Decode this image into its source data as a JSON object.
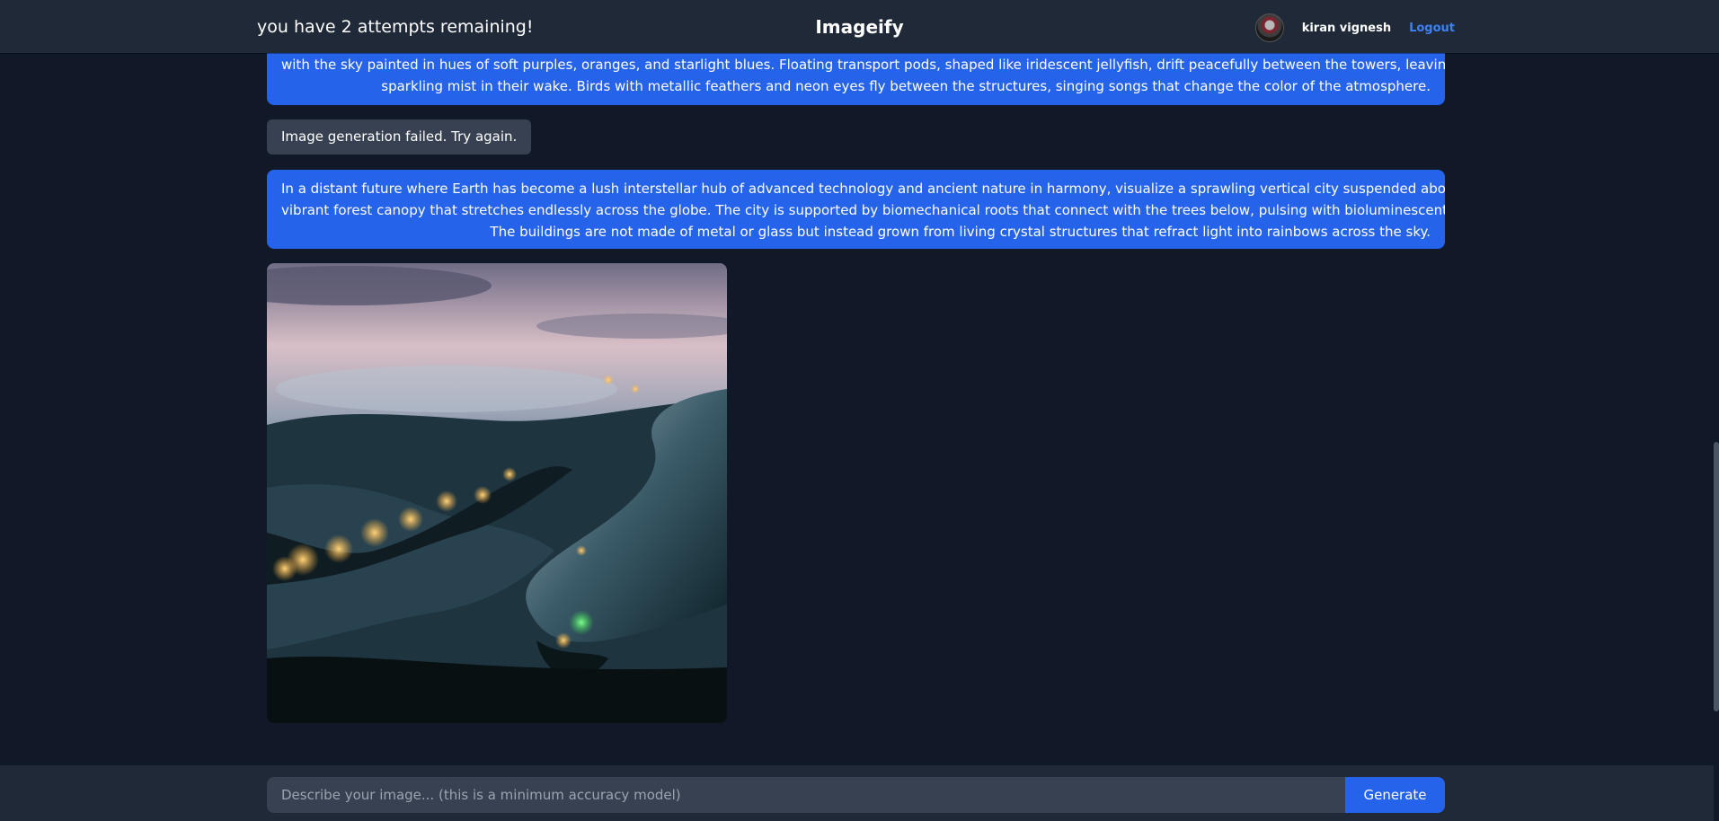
{
  "header": {
    "attempts_text": "you have 2 attempts remaining!",
    "brand": "Imageify",
    "user_name": "kiran vignesh",
    "logout_label": "Logout"
  },
  "chat": {
    "previous_prompt_lines": [
      "with the sky painted in hues of soft purples, oranges, and starlight blues. Floating transport pods, shaped like iridescent jellyfish, drift peacefully between the towers, leaving trails of",
      "sparkling mist in their wake. Birds with metallic feathers and neon eyes fly between the structures, singing songs that change the color of the atmosphere."
    ],
    "error_message": "Image generation failed. Try again.",
    "current_prompt_lines": [
      "In a distant future where Earth has become a lush interstellar hub of advanced technology and ancient nature in harmony, visualize a sprawling vertical city suspended above a",
      "vibrant forest canopy that stretches endlessly across the globe. The city is supported by biomechanical roots that connect with the trees below, pulsing with bioluminescent energy.",
      "The buildings are not made of metal or glass but instead grown from living crystal structures that refract light into rainbows across the sky."
    ]
  },
  "footer": {
    "input_placeholder": "Describe your image... (this is a minimum accuracy model)",
    "input_value": "",
    "generate_label": "Generate"
  },
  "colors": {
    "background": "#111827",
    "header": "#1f2937",
    "user_bubble": "#2563eb",
    "error_bubble": "#374151",
    "logout": "#3b82f6"
  }
}
